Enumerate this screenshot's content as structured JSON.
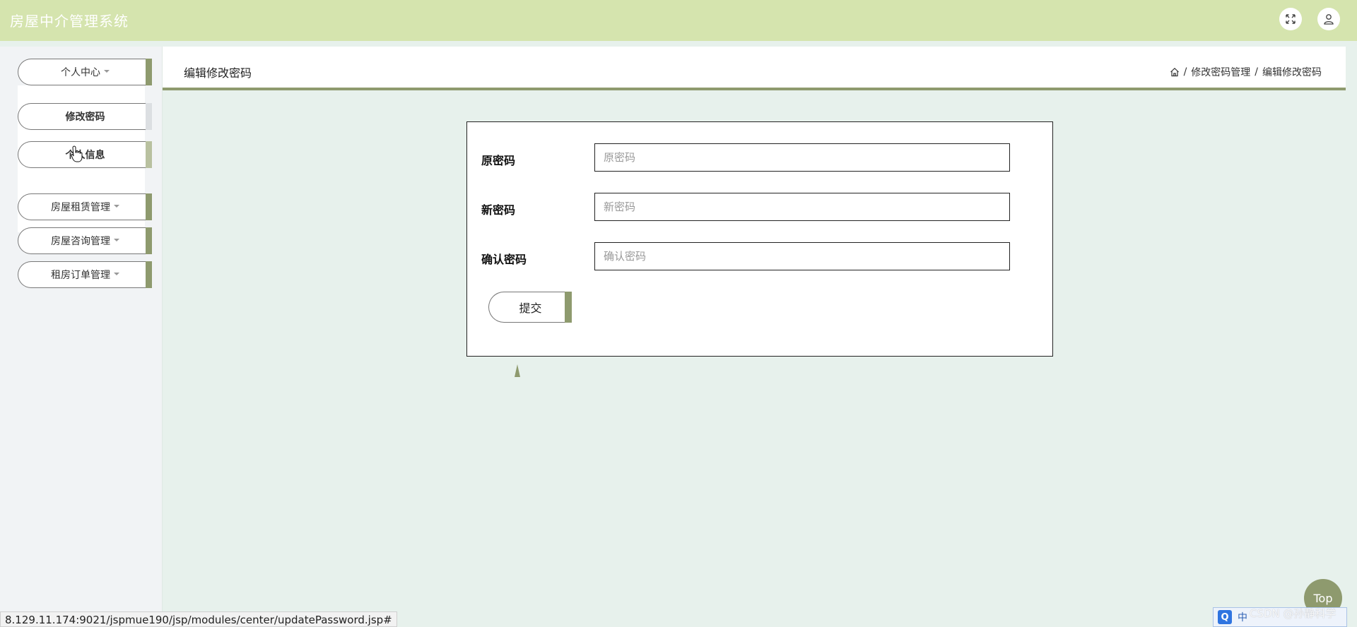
{
  "app": {
    "title": "房屋中介管理系统"
  },
  "header": {
    "expand_icon": "fullscreen-icon",
    "user_icon": "user-icon"
  },
  "sidebar": {
    "menus": [
      {
        "label": "个人中心",
        "expanded": true,
        "children": [
          {
            "label": "修改密码"
          },
          {
            "label": "个人信息"
          }
        ]
      },
      {
        "label": "房屋租赁管理"
      },
      {
        "label": "房屋咨询管理"
      },
      {
        "label": "租房订单管理"
      }
    ]
  },
  "content": {
    "heading": "编辑修改密码",
    "breadcrumb": {
      "home_icon": "home-icon",
      "separator": "/",
      "items": [
        "修改密码管理",
        "编辑修改密码"
      ]
    }
  },
  "form": {
    "fields": [
      {
        "label": "原密码",
        "placeholder": "原密码",
        "value": ""
      },
      {
        "label": "新密码",
        "placeholder": "新密码",
        "value": ""
      },
      {
        "label": "确认密码",
        "placeholder": "确认密码",
        "value": ""
      }
    ],
    "submit_label": "提交"
  },
  "status_bar": {
    "url": "8.129.11.174:9021/jspmue190/jsp/modules/center/updatePassword.jsp#"
  },
  "back_to_top": {
    "label": "Top"
  },
  "ime": {
    "logo": "Q",
    "mode": "中"
  },
  "watermark": {
    "text": "CSDN @孙静科学"
  },
  "colors": {
    "header_bg": "#d5e4ae",
    "accent": "#8e9a6e",
    "page_bg": "#e7f1ec",
    "sidebar_bg": "#f1f3f5"
  }
}
